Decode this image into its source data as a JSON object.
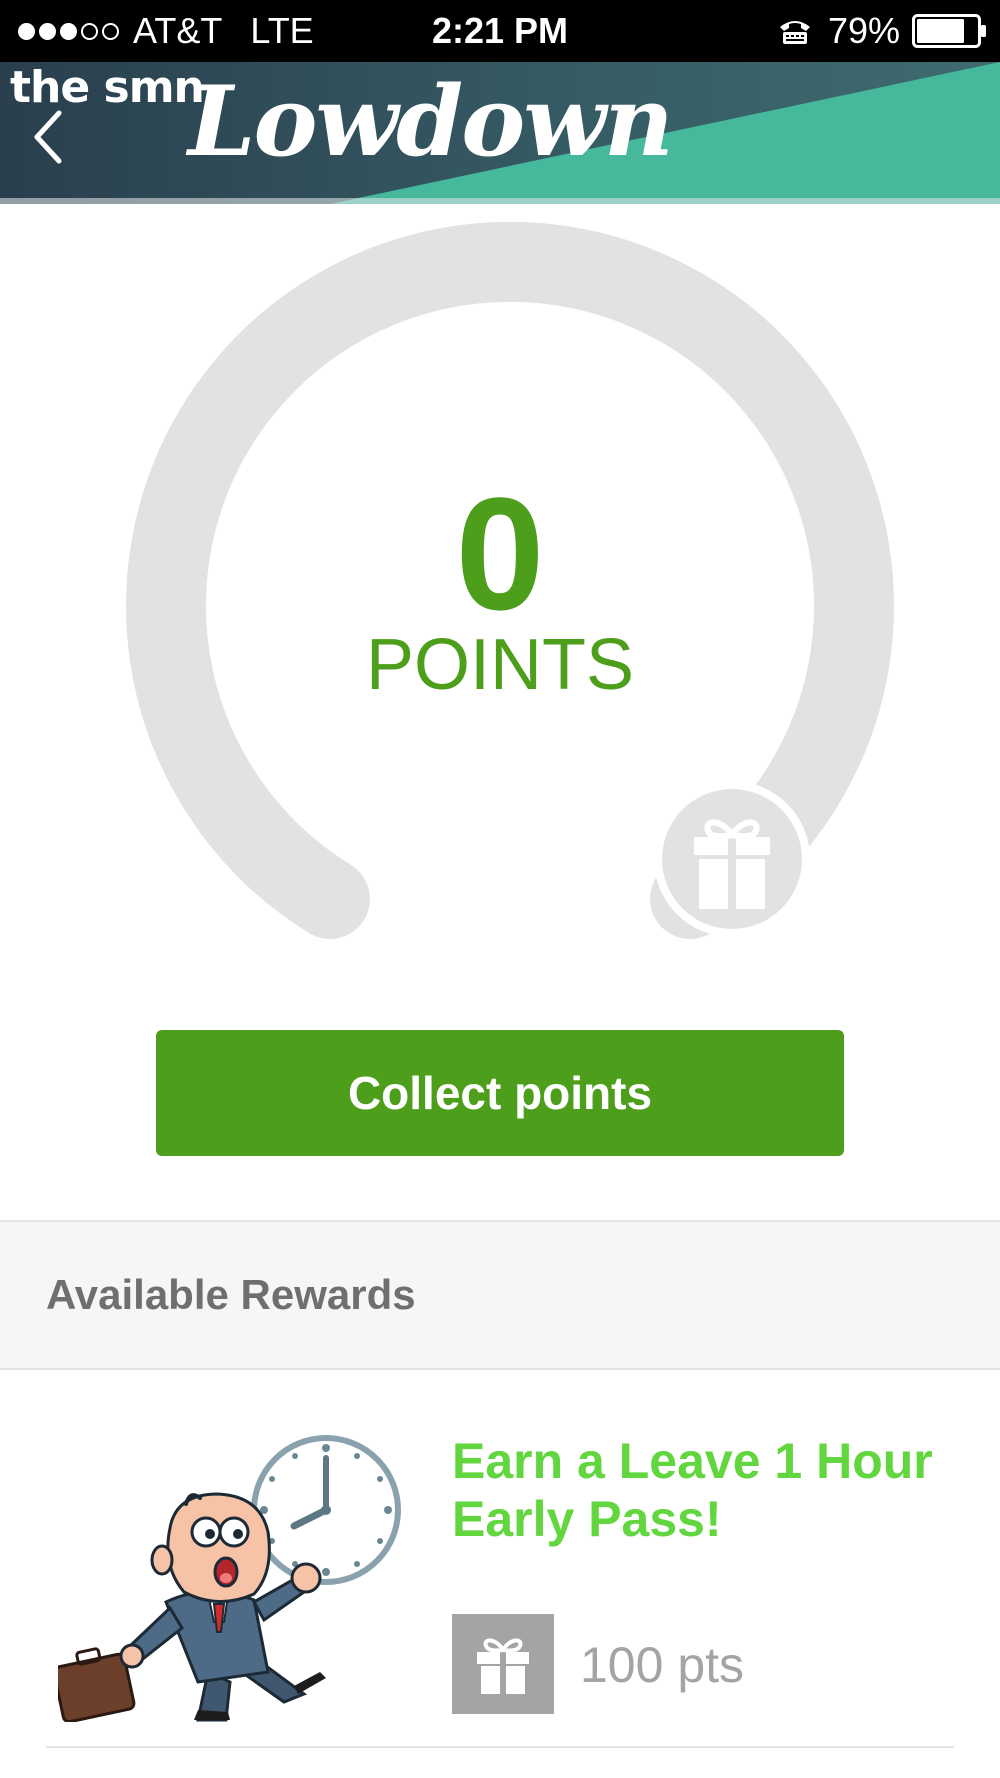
{
  "status_bar": {
    "signal_filled": 3,
    "signal_total": 5,
    "carrier": "AT&T",
    "network": "LTE",
    "time": "2:21 PM",
    "battery_percent": "79%",
    "battery_level": 0.79,
    "tty_icon": "tty-phone-icon",
    "battery_icon": "battery-icon"
  },
  "header": {
    "back_icon": "chevron-left-icon",
    "brand_small": "the smn",
    "brand_script": "Lowdown",
    "colors": {
      "dark": "#2f4b5a",
      "teal": "#46b89b"
    }
  },
  "points": {
    "value": "0",
    "label": "POINTS",
    "gift_icon": "gift-icon",
    "colors": {
      "value": "#4c9e1b",
      "track": "#e2e2e2"
    }
  },
  "collect_button": {
    "label": "Collect points",
    "color": "#4c9e1b"
  },
  "rewards": {
    "title": "Available Rewards",
    "items": [
      {
        "title": "Earn a Leave 1 Hour Early Pass!",
        "points": "100 pts",
        "icon": "gift-icon",
        "image": "businessman-running-late-illustration",
        "title_color": "#62d63e"
      }
    ]
  }
}
